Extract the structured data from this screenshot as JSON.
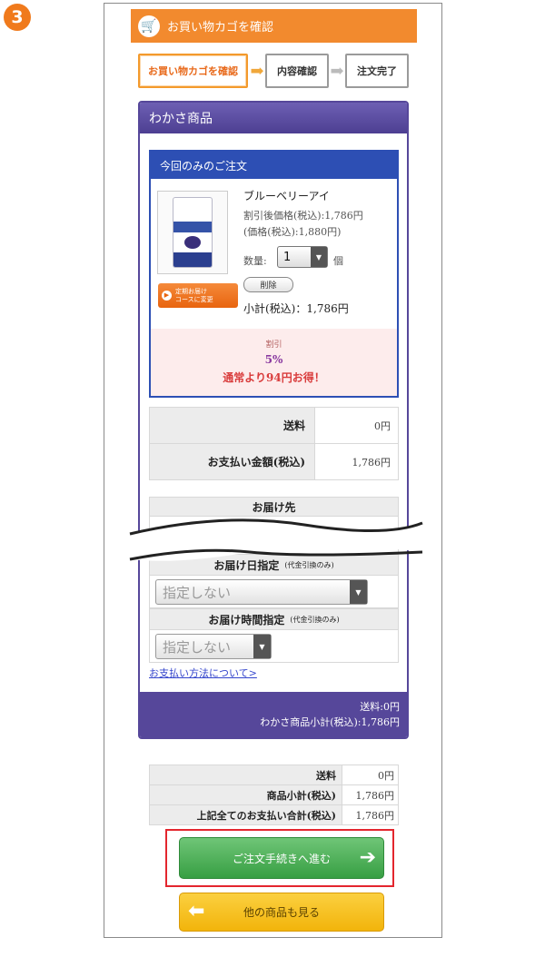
{
  "step_badge": "3",
  "header": {
    "title": "お買い物カゴを確認",
    "icon": "cart-icon"
  },
  "steps": [
    {
      "label": "お買い物カゴを確認",
      "active": true
    },
    {
      "label": "内容確認",
      "active": false
    },
    {
      "label": "注文完了",
      "active": false
    }
  ],
  "panel": {
    "title": "わかさ商品",
    "order_title": "今回のみのご注文",
    "product": {
      "name": "ブルーベリーアイ",
      "discount_price": "割引後価格(税込):1,786円",
      "price": "(価格(税込):1,880円)",
      "qty_label": "数量:",
      "qty_value": "1",
      "qty_unit": "個",
      "delete_label": "削除",
      "teiki_label_1": "定期お届け",
      "teiki_label_2": "コースに変更",
      "subtotal": "小計(税込)：1,786円"
    },
    "discount": {
      "label": "割引",
      "rate": "5%",
      "note": "通常より94円お得！"
    },
    "summary": [
      {
        "label": "送料",
        "value": "0円"
      },
      {
        "label": "お支払い金額(税込)",
        "value": "1,786円"
      }
    ],
    "delivery_to_label": "お届け先",
    "delivery_date_label": "お届け日指定",
    "delivery_date_note": "(代金引換のみ)",
    "delivery_date_value": "指定しない",
    "delivery_time_label": "お届け時間指定",
    "delivery_time_note": "(代金引換のみ)",
    "delivery_time_value": "指定しない",
    "payment_link": "お支払い方法について>",
    "footer_shipping": "送料:0円",
    "footer_subtotal": "わかさ商品小計(税込):1,786円"
  },
  "totals": [
    {
      "label": "送料",
      "value": "0円"
    },
    {
      "label": "商品小計(税込)",
      "value": "1,786円"
    },
    {
      "label": "上記全てのお支払い合計(税込)",
      "value": "1,786円"
    }
  ],
  "buttons": {
    "proceed": "ご注文手続きへ進む",
    "other": "他の商品も見る"
  },
  "colors": {
    "header_orange": "#f28a2e",
    "panel_purple": "#56479a",
    "order_blue": "#2d4fb4",
    "proceed_green": "#379f43",
    "other_yellow": "#f2b40b",
    "highlight_red": "#e3262e"
  }
}
